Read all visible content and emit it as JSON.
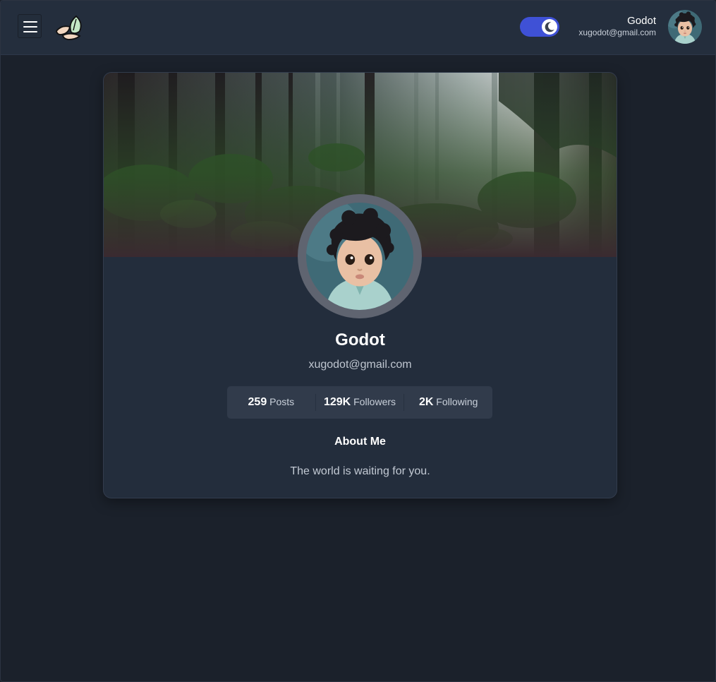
{
  "header": {
    "menu_icon": "hamburger-menu-icon",
    "logo_icon": "leaf-logo-icon",
    "theme_toggle": {
      "state": "dark",
      "icon": "moon-icon",
      "accent": "#3f51d6"
    },
    "user": {
      "name": "Godot",
      "email": "xugodot@gmail.com",
      "avatar_icon": "child-avatar-photo"
    }
  },
  "profile": {
    "cover_image": "forest-cover-photo",
    "avatar_icon": "child-avatar-photo",
    "name": "Godot",
    "email": "xugodot@gmail.com",
    "stats": [
      {
        "value": "259",
        "label": "Posts"
      },
      {
        "value": "129K",
        "label": "Followers"
      },
      {
        "value": "2K",
        "label": "Following"
      }
    ],
    "about_title": "About Me",
    "about_text": "The world is waiting for you."
  },
  "colors": {
    "page_bg": "#1b212b",
    "header_bg": "#242e3d",
    "card_bg": "#232d3c",
    "stats_bg": "#313b4b",
    "toggle": "#3f51d6"
  }
}
